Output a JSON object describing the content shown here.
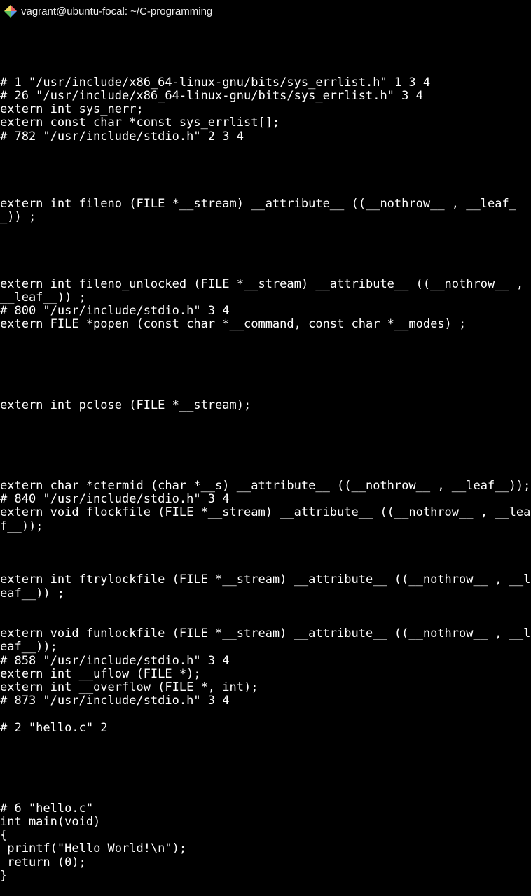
{
  "window": {
    "title": "vagrant@ubuntu-focal: ~/C-programming"
  },
  "terminal": {
    "lines": [
      "",
      "",
      "",
      "",
      "# 1 \"/usr/include/x86_64-linux-gnu/bits/sys_errlist.h\" 1 3 4",
      "# 26 \"/usr/include/x86_64-linux-gnu/bits/sys_errlist.h\" 3 4",
      "extern int sys_nerr;",
      "extern const char *const sys_errlist[];",
      "# 782 \"/usr/include/stdio.h\" 2 3 4",
      "",
      "",
      "",
      "",
      "extern int fileno (FILE *__stream) __attribute__ ((__nothrow__ , __leaf__)) ;",
      "",
      "",
      "",
      "",
      "extern int fileno_unlocked (FILE *__stream) __attribute__ ((__nothrow__ , __leaf__)) ;",
      "# 800 \"/usr/include/stdio.h\" 3 4",
      "extern FILE *popen (const char *__command, const char *__modes) ;",
      "",
      "",
      "",
      "",
      "",
      "extern int pclose (FILE *__stream);",
      "",
      "",
      "",
      "",
      "",
      "extern char *ctermid (char *__s) __attribute__ ((__nothrow__ , __leaf__));",
      "# 840 \"/usr/include/stdio.h\" 3 4",
      "extern void flockfile (FILE *__stream) __attribute__ ((__nothrow__ , __leaf__));",
      "",
      "",
      "",
      "extern int ftrylockfile (FILE *__stream) __attribute__ ((__nothrow__ , __leaf__)) ;",
      "",
      "",
      "extern void funlockfile (FILE *__stream) __attribute__ ((__nothrow__ , __leaf__));",
      "# 858 \"/usr/include/stdio.h\" 3 4",
      "extern int __uflow (FILE *);",
      "extern int __overflow (FILE *, int);",
      "# 873 \"/usr/include/stdio.h\" 3 4",
      "",
      "# 2 \"hello.c\" 2",
      "",
      "",
      "",
      "",
      "",
      "# 6 \"hello.c\"",
      "int main(void)",
      "{",
      " printf(\"Hello World!\\n\");",
      " return (0);",
      "}"
    ]
  }
}
